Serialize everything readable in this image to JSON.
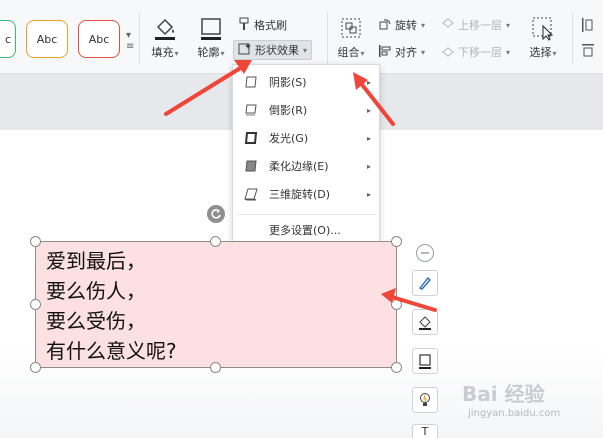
{
  "ribbon": {
    "style_swatches": [
      {
        "label": "c",
        "color": "#3cb878"
      },
      {
        "label": "Abc",
        "color": "#f0a020"
      },
      {
        "label": "Abc",
        "color": "#e0503c"
      }
    ],
    "fill_label": "填充",
    "outline_label": "轮廓",
    "format_painter_label": "格式刷",
    "shape_effects_label": "形状效果",
    "group_label": "组合",
    "rotate_label": "旋转",
    "align_label": "对齐",
    "bring_forward_label": "上移一层",
    "send_backward_label": "下移一层",
    "select_label": "选择"
  },
  "shape_effects_menu": {
    "items": [
      {
        "label": "阴影(S)",
        "icon": "shadow-icon"
      },
      {
        "label": "倒影(R)",
        "icon": "reflection-icon"
      },
      {
        "label": "发光(G)",
        "icon": "glow-icon"
      },
      {
        "label": "柔化边缘(E)",
        "icon": "soft-edge-icon"
      },
      {
        "label": "三维旋转(D)",
        "icon": "3d-rotation-icon"
      }
    ],
    "more_settings": "更多设置(O)..."
  },
  "shape": {
    "lines": [
      "爱到最后，",
      "要么伤人，",
      "要么受伤，",
      "有什么意义呢?"
    ]
  },
  "watermark": {
    "line1": "Bai 经验",
    "line2": "jingyan.baidu.com"
  },
  "colors": {
    "accent_arrow": "#f0463a",
    "shape_fill": "#fce0e2"
  }
}
